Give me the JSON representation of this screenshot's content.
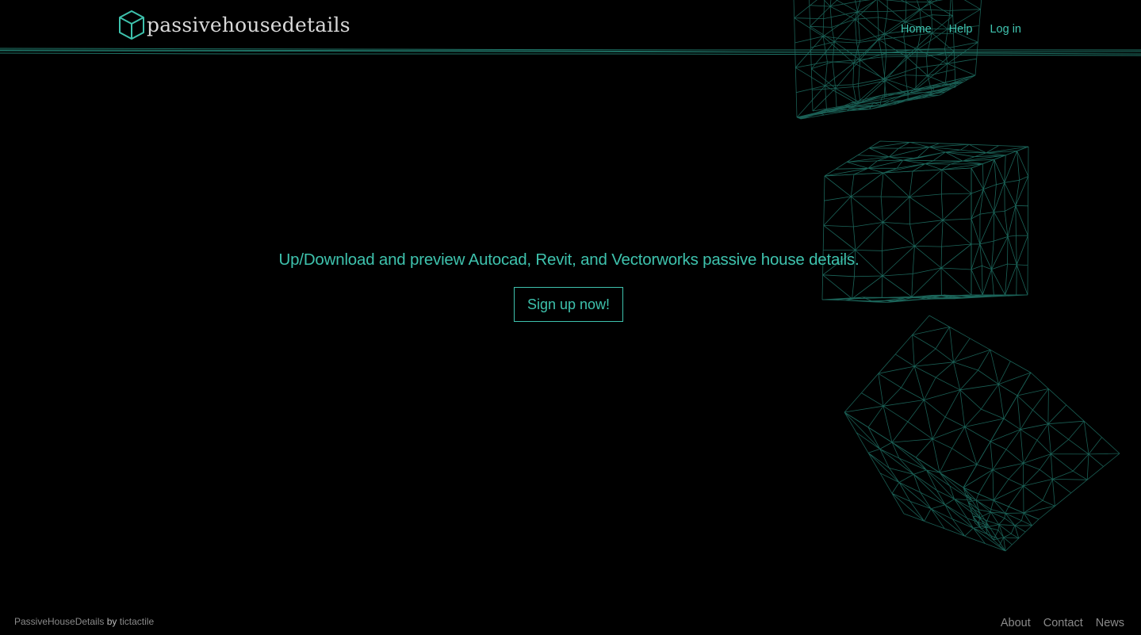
{
  "brand": {
    "name": "passivehousedetails",
    "accent_color": "#3ec2ad",
    "icon": "cube-icon"
  },
  "nav": {
    "items": [
      {
        "label": "Home"
      },
      {
        "label": "Help"
      },
      {
        "label": "Log in"
      }
    ]
  },
  "hero": {
    "tagline": "Up/Download and preview Autocad, Revit, and Vectorworks passive house details.",
    "cta_label": "Sign up now!"
  },
  "footer": {
    "site_name": "PassiveHouseDetails",
    "by_text": "by",
    "author": "tictactile",
    "links": [
      {
        "label": "About"
      },
      {
        "label": "Contact"
      },
      {
        "label": "News"
      }
    ]
  },
  "background": {
    "type": "wireframe-geodesic-shapes",
    "line_color": "#1f6f63"
  }
}
